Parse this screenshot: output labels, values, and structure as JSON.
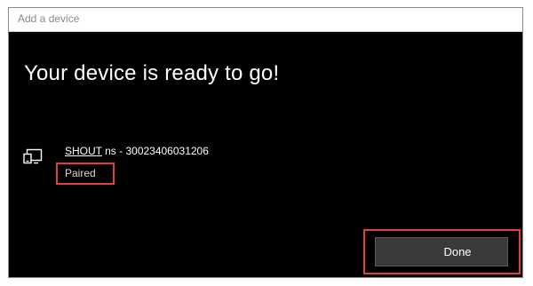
{
  "window": {
    "title": "Add a device"
  },
  "main": {
    "heading": "Your device is ready to go!",
    "device": {
      "icon": "device-pair-icon",
      "name_underlined": "SHOUT",
      "name_rest": " ns - 30023406031206",
      "status": "Paired"
    }
  },
  "footer": {
    "done_label": "Done"
  },
  "colors": {
    "background": "#000000",
    "highlight": "#e53e3e",
    "button": "#3a3a3a"
  }
}
